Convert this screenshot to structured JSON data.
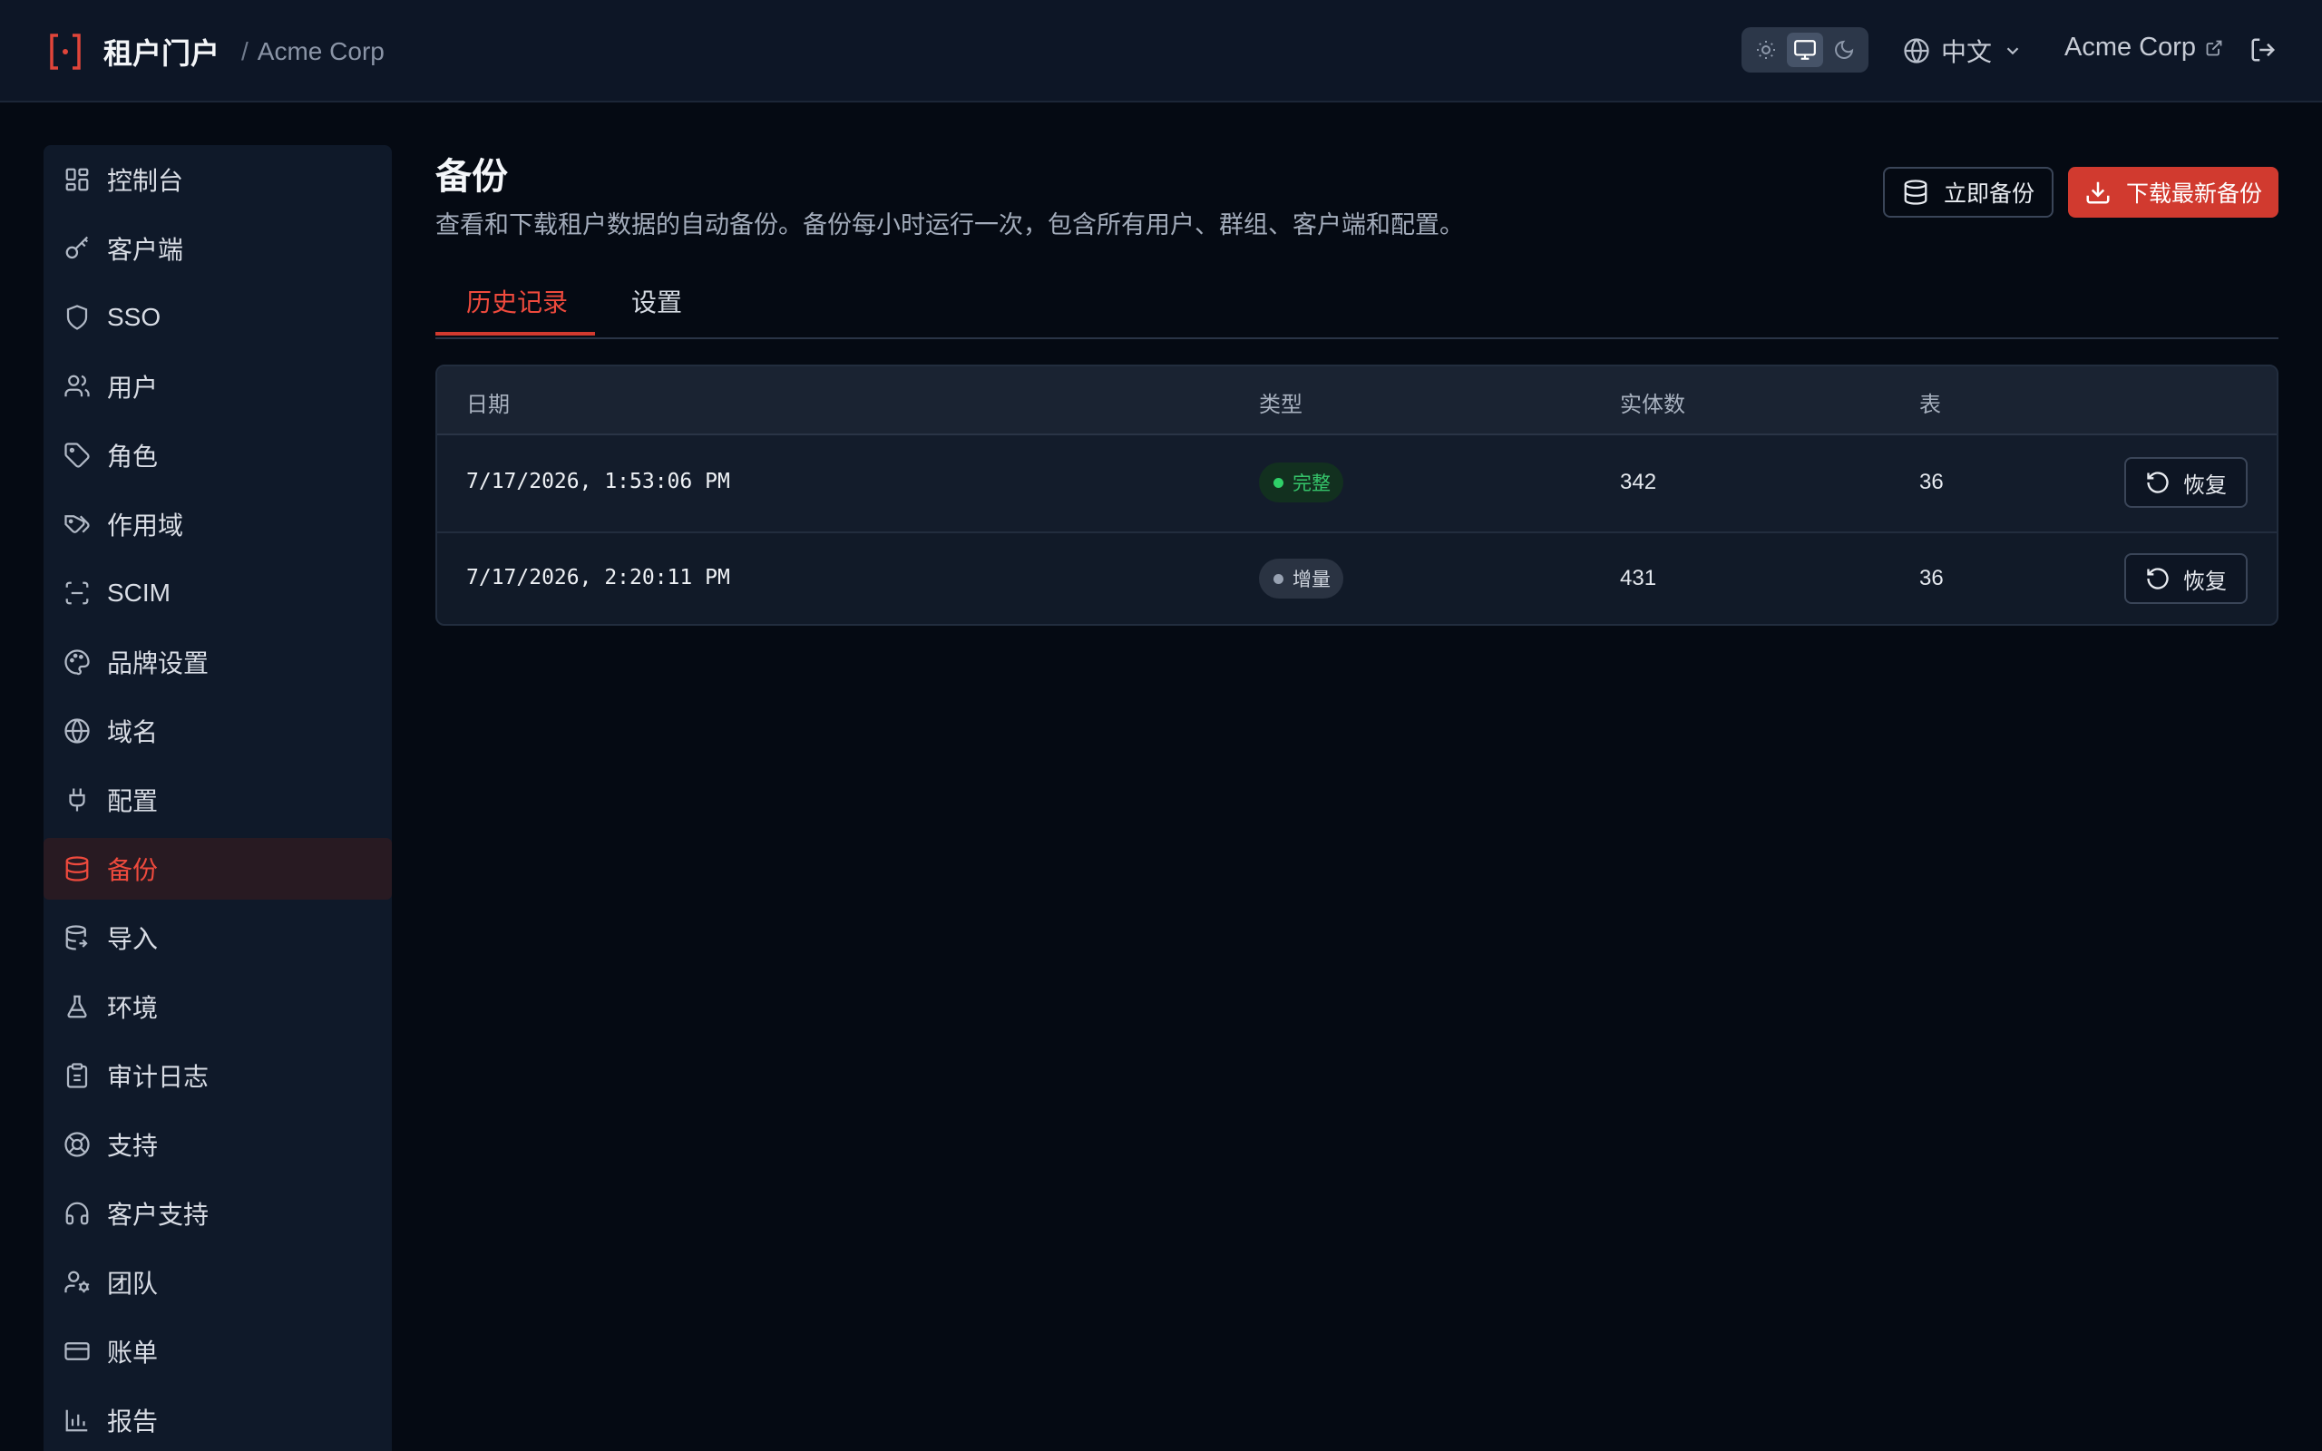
{
  "header": {
    "app_title": "租户门户",
    "separator": "/",
    "tenant_name": "Acme Corp",
    "language": "中文",
    "tenant_link": "Acme Corp",
    "theme_modes": [
      "light-icon",
      "monitor-icon",
      "moon-icon"
    ],
    "active_theme": "monitor-icon"
  },
  "sidebar": {
    "items": [
      {
        "label": "控制台",
        "icon": "dashboard-icon"
      },
      {
        "label": "客户端",
        "icon": "key-icon"
      },
      {
        "label": "SSO",
        "icon": "shield-icon"
      },
      {
        "label": "用户",
        "icon": "users-icon"
      },
      {
        "label": "角色",
        "icon": "tag-icon"
      },
      {
        "label": "作用域",
        "icon": "tags-icon"
      },
      {
        "label": "SCIM",
        "icon": "scan-icon"
      },
      {
        "label": "品牌设置",
        "icon": "palette-icon"
      },
      {
        "label": "域名",
        "icon": "globe-icon"
      },
      {
        "label": "配置",
        "icon": "plug-icon"
      },
      {
        "label": "备份",
        "icon": "database-icon"
      },
      {
        "label": "导入",
        "icon": "database-import-icon"
      },
      {
        "label": "环境",
        "icon": "flask-icon"
      },
      {
        "label": "审计日志",
        "icon": "clipboard-icon"
      },
      {
        "label": "支持",
        "icon": "lifebuoy-icon"
      },
      {
        "label": "客户支持",
        "icon": "headphones-icon"
      },
      {
        "label": "团队",
        "icon": "user-cog-icon"
      },
      {
        "label": "账单",
        "icon": "credit-card-icon"
      },
      {
        "label": "报告",
        "icon": "bar-chart-icon"
      }
    ],
    "active_index": 10
  },
  "page": {
    "title": "备份",
    "description": "查看和下载租户数据的自动备份。备份每小时运行一次，包含所有用户、群组、客户端和配置。",
    "backup_now_label": "立即备份",
    "download_latest_label": "下载最新备份"
  },
  "tabs": [
    {
      "label": "历史记录",
      "active": true
    },
    {
      "label": "设置",
      "active": false
    }
  ],
  "table": {
    "columns": [
      "日期",
      "类型",
      "实体数",
      "表"
    ],
    "rows": [
      {
        "date": "7/17/2026, 1:53:06 PM",
        "type": "完整",
        "type_kind": "full",
        "entities": "342",
        "tables": "36",
        "action": "恢复"
      },
      {
        "date": "7/17/2026, 2:20:11 PM",
        "type": "增量",
        "type_kind": "incremental",
        "entities": "431",
        "tables": "36",
        "action": "恢复"
      }
    ]
  },
  "colors": {
    "accent": "#d13a2f",
    "accent_text": "#ef4a3d",
    "full_badge": "#2fcf68",
    "background": "#050a13"
  }
}
